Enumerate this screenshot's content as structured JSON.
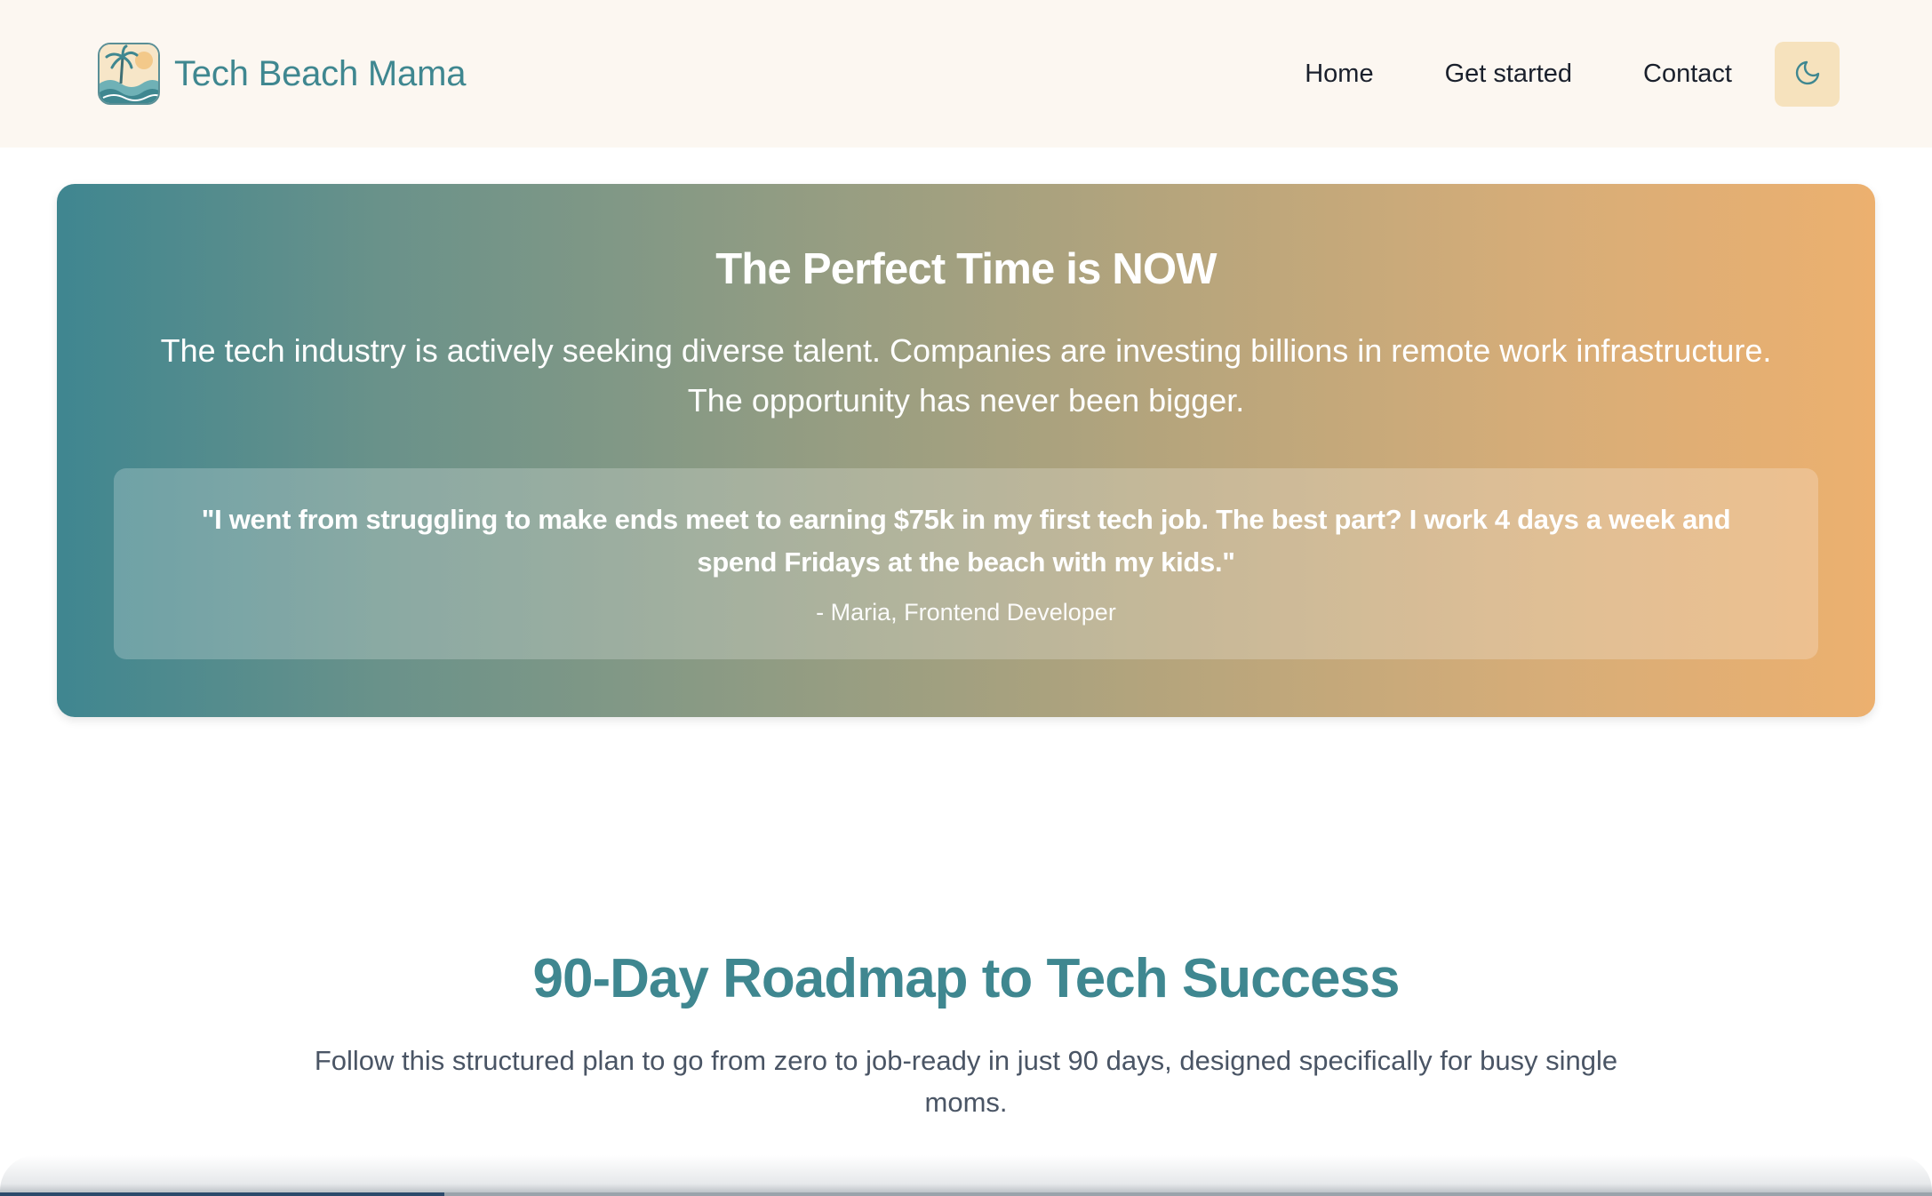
{
  "header": {
    "brand_name": "Tech Beach Mama",
    "logo_icon": "palm-beach-wave-logo",
    "nav": [
      {
        "label": "Home"
      },
      {
        "label": "Get started"
      },
      {
        "label": "Contact"
      }
    ],
    "theme_toggle_icon": "moon-icon"
  },
  "hero": {
    "title": "The Perfect Time is NOW",
    "text": "The tech industry is actively seeking diverse talent. Companies are investing billions in remote work infrastructure. The opportunity has never been bigger.",
    "quote": "\"I went from struggling to make ends meet to earning $75k in my first tech job. The best part? I work 4 days a week and spend Fridays at the beach with my kids.\"",
    "quote_author": "- Maria, Frontend Developer"
  },
  "roadmap": {
    "title": "90-Day Roadmap to Tech Success",
    "description": "Follow this structured plan to go from zero to job-ready in just 90 days, designed specifically for busy single moms."
  },
  "colors": {
    "brand_teal": "#3f8790",
    "header_bg": "#fcf7f1",
    "toggle_bg": "#f6e2bd",
    "gradient_start": "#3f8690",
    "gradient_end": "#ecb06f",
    "body_text": "#4a5565"
  }
}
